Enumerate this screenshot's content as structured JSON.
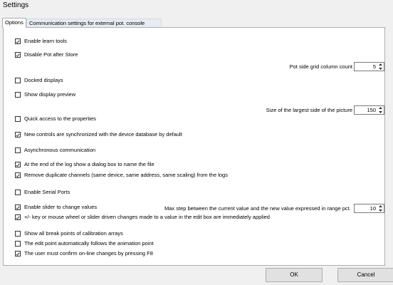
{
  "window": {
    "title": "Settings"
  },
  "tabs": [
    {
      "label": "Options",
      "active": true
    },
    {
      "label": "Communication settings for external pot. console",
      "active": false
    }
  ],
  "options": [
    {
      "label": "Enable learn tools",
      "checked": true
    },
    {
      "label": "Disable Pot after Store",
      "checked": true
    },
    {
      "label": "Docked displays",
      "checked": false
    },
    {
      "label": "Show display preview",
      "checked": false
    },
    {
      "label": "Quick access to the properties",
      "checked": false
    },
    {
      "label": "New controls are synchronized with the device database by default",
      "checked": true
    },
    {
      "label": "Asynchronous communication",
      "checked": false
    },
    {
      "label": "At the end of the log show a dialog box to name the file",
      "checked": true
    },
    {
      "label": "Remove duplicate channels (same device, same address, same scaling) from the logs",
      "checked": true
    },
    {
      "label": "Enable Serial Ports",
      "checked": false
    },
    {
      "label": "Enable slider to change values",
      "checked": true
    },
    {
      "label": "+/- key or mouse wheel or slider driven changes made to a value in the edit box are immediately applied",
      "checked": true
    },
    {
      "label": "Show all break points of calibration arrays",
      "checked": false
    },
    {
      "label": "The edit point automatically follows the animation point",
      "checked": false
    },
    {
      "label": "The user must confirm on-line changes by pressing F8",
      "checked": true
    }
  ],
  "fields": {
    "grid_columns": {
      "label": "Pot side grid column count",
      "value": "5"
    },
    "picture_size": {
      "label": "Size of the largest side of the picture",
      "value": "150"
    },
    "max_step": {
      "label": "Max step between the current value and the new value expressed in range pct.",
      "value": "10"
    }
  },
  "buttons": {
    "ok": "OK",
    "cancel": "Cancel"
  },
  "colors": {
    "dialog_bg": "#f0f0f0",
    "panel_bg": "#ffffff",
    "border": "#adadad"
  }
}
